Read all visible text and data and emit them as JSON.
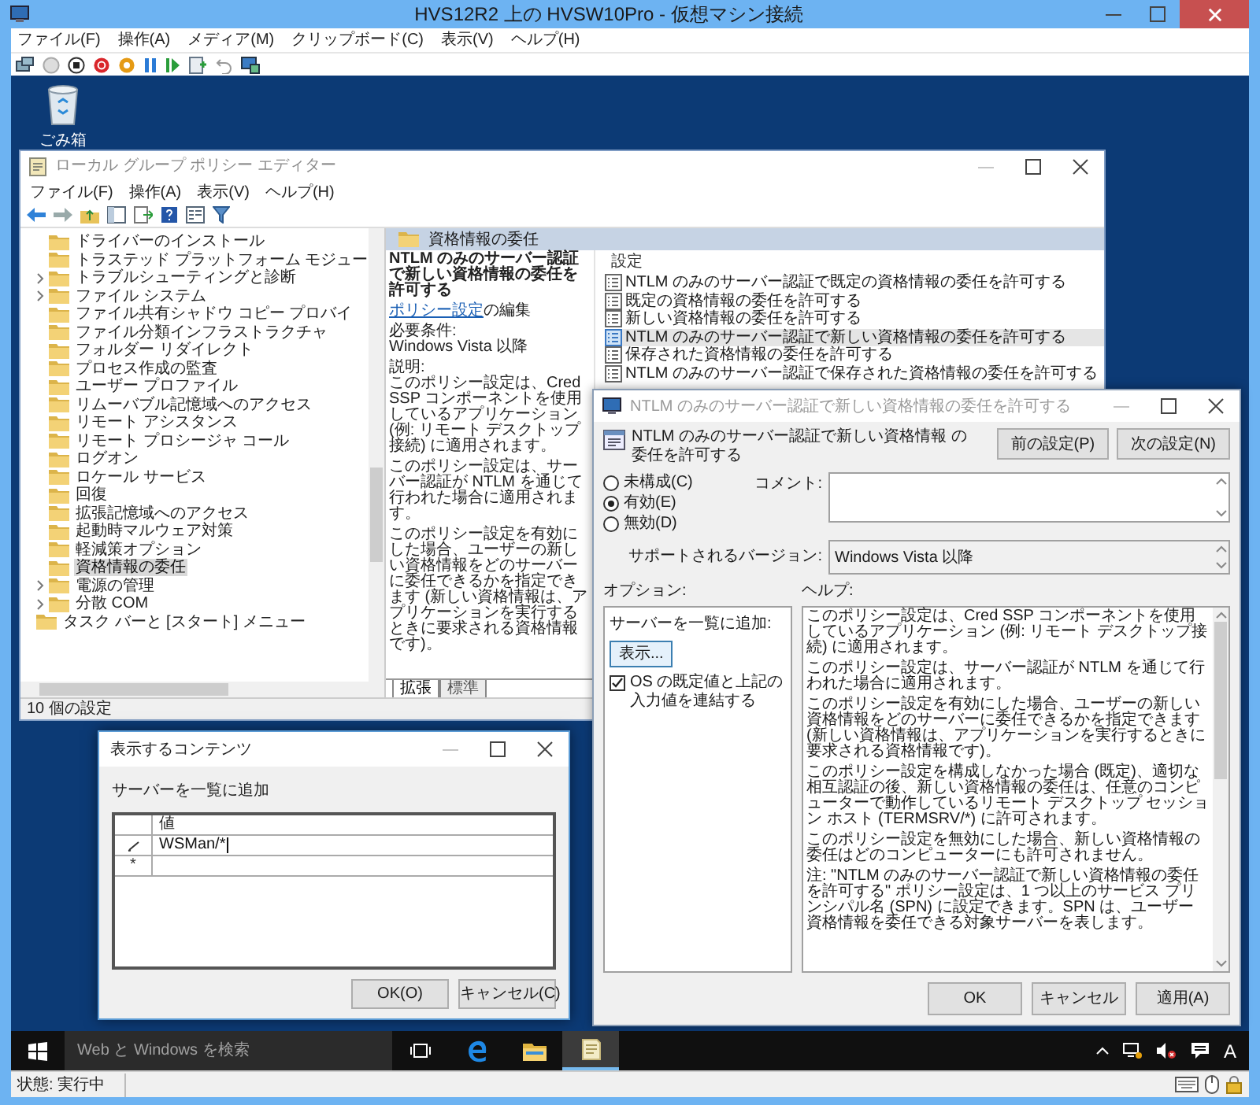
{
  "vm_window": {
    "title": "HVS12R2 上の HVSW10Pro - 仮想マシン接続",
    "menu": [
      "ファイル(F)",
      "操作(A)",
      "メディア(M)",
      "クリップボード(C)",
      "表示(V)",
      "ヘルプ(H)"
    ]
  },
  "desktop_icons": [
    {
      "label": "ごみ箱"
    }
  ],
  "policy_editor": {
    "title": "ローカル グループ ポリシー エディター",
    "menu": [
      "ファイル(F)",
      "操作(A)",
      "表示(V)",
      "ヘルプ(H)"
    ],
    "tree": {
      "children": [
        {
          "label": "ドライバーのインストール",
          "expandable": false,
          "selected": false
        },
        {
          "label": "トラステッド プラットフォーム モジュー",
          "expandable": false,
          "selected": false
        },
        {
          "label": "トラブルシューティングと診断",
          "expandable": true,
          "selected": false
        },
        {
          "label": "ファイル システム",
          "expandable": true,
          "selected": false
        },
        {
          "label": "ファイル共有シャドウ コピー プロバイ",
          "expandable": false,
          "selected": false
        },
        {
          "label": "ファイル分類インフラストラクチャ",
          "expandable": false,
          "selected": false
        },
        {
          "label": "フォルダー リダイレクト",
          "expandable": false,
          "selected": false
        },
        {
          "label": "プロセス作成の監査",
          "expandable": false,
          "selected": false
        },
        {
          "label": "ユーザー プロファイル",
          "expandable": false,
          "selected": false
        },
        {
          "label": "リムーバブル記憶域へのアクセス",
          "expandable": false,
          "selected": false
        },
        {
          "label": "リモート アシスタンス",
          "expandable": false,
          "selected": false
        },
        {
          "label": "リモート プロシージャ コール",
          "expandable": false,
          "selected": false
        },
        {
          "label": "ログオン",
          "expandable": false,
          "selected": false
        },
        {
          "label": "ロケール サービス",
          "expandable": false,
          "selected": false
        },
        {
          "label": "回復",
          "expandable": false,
          "selected": false
        },
        {
          "label": "拡張記憶域へのアクセス",
          "expandable": false,
          "selected": false
        },
        {
          "label": "起動時マルウェア対策",
          "expandable": false,
          "selected": false
        },
        {
          "label": "軽減策オプション",
          "expandable": false,
          "selected": false
        },
        {
          "label": "資格情報の委任",
          "expandable": false,
          "selected": true
        },
        {
          "label": "電源の管理",
          "expandable": true,
          "selected": false
        },
        {
          "label": "分散 COM",
          "expandable": true,
          "selected": false
        }
      ],
      "after": [
        {
          "label": "タスク バーと [スタート] メニュー",
          "expandable": false,
          "selected": false
        }
      ]
    },
    "header": "資格情報の委任",
    "description": {
      "title": "NTLM のみのサーバー認証で新しい資格情報の委任を許可する",
      "link": "ポリシー設定",
      "link_suffix": "の編集",
      "requirements_label": "必要条件:",
      "requirements": "Windows Vista 以降",
      "description_label": "説明:",
      "paragraphs": [
        "このポリシー設定は、Cred SSP コンポーネントを使用しているアプリケーション (例: リモート デスクトップ接続) に適用されます。",
        "このポリシー設定は、サーバー認証が NTLM を通じて行われた場合に適用されます。",
        "このポリシー設定を有効にした場合、ユーザーの新しい資格情報をどのサーバーに委任できるかを指定できます (新しい資格情報は、アプリケーションを実行するときに要求される資格情報です)。"
      ]
    },
    "settings": {
      "header": "設定",
      "items": [
        {
          "label": "NTLM のみのサーバー認証で既定の資格情報の委任を許可する",
          "selected": false
        },
        {
          "label": "既定の資格情報の委任を許可する",
          "selected": false
        },
        {
          "label": "新しい資格情報の委任を許可する",
          "selected": false
        },
        {
          "label": "NTLM のみのサーバー認証で新しい資格情報の委任を許可する",
          "selected": true
        },
        {
          "label": "保存された資格情報の委任を許可する",
          "selected": false
        },
        {
          "label": "NTLM のみのサーバー認証で保存された資格情報の委任を許可する",
          "selected": false
        }
      ]
    },
    "tabs": [
      {
        "label": "拡張",
        "selected": true
      },
      {
        "label": "標準",
        "selected": false
      }
    ],
    "status": "10 個の設定"
  },
  "policy_dialog": {
    "title": "NTLM のみのサーバー認証で新しい資格情報の委任を許可する",
    "heading": "NTLM のみのサーバー認証で新しい資格情報 の委任を許可する",
    "nav_buttons": [
      "前の設定(P)",
      "次の設定(N)"
    ],
    "radios": [
      {
        "label": "未構成(C)",
        "selected": false
      },
      {
        "label": "有効(E)",
        "selected": true
      },
      {
        "label": "無効(D)",
        "selected": false
      }
    ],
    "comment_label": "コメント:",
    "supported_label": "サポートされるバージョン:",
    "supported": "Windows Vista 以降",
    "options_label": "オプション:",
    "help_label": "ヘルプ:",
    "options": {
      "list_label": "サーバーを一覧に追加:",
      "show_button": "表示...",
      "checkbox": {
        "label": "OS の既定値と上記の入力値を連結する",
        "checked": true
      }
    },
    "help": [
      "このポリシー設定は、Cred SSP コンポーネントを使用しているアプリケーション (例: リモート デスクトップ接続) に適用されます。",
      "このポリシー設定は、サーバー認証が NTLM を通じて行われた場合に適用されます。",
      "このポリシー設定を有効にした場合、ユーザーの新しい資格情報をどのサーバーに委任できるかを指定できます (新しい資格情報は、アプリケーションを実行するときに要求される資格情報です)。",
      "このポリシー設定を構成しなかった場合 (既定)、適切な相互認証の後、新しい資格情報の委任は、任意のコンピューターで動作しているリモート デスクトップ セッション ホスト (TERMSRV/*) に許可されます。",
      "このポリシー設定を無効にした場合、新しい資格情報の委任はどのコンピューターにも許可されません。",
      "注: \"NTLM のみのサーバー認証で新しい資格情報の委任を許可する\" ポリシー設定は、1 つ以上のサービス プリンシパル名 (SPN) に設定できます。SPN は、ユーザー資格情報を委任できる対象サーバーを表します。"
    ],
    "buttons": [
      "OK",
      "キャンセル",
      "適用(A)"
    ]
  },
  "contents_dialog": {
    "title": "表示するコンテンツ",
    "label": "サーバーを一覧に追加",
    "column": "値",
    "rows": [
      {
        "kind": "editing",
        "value": "WSMan/*"
      },
      {
        "kind": "new",
        "marker": "*"
      }
    ],
    "buttons": [
      "OK(O)",
      "キャンセル(C)"
    ]
  },
  "taskbar": {
    "search_placeholder": "Web と Windows を検索",
    "apps": [
      {
        "kind": "task-view",
        "selected": false
      },
      {
        "kind": "edge",
        "selected": false
      },
      {
        "kind": "explorer",
        "selected": false
      },
      {
        "kind": "editor",
        "selected": true
      }
    ],
    "ime": "A"
  },
  "status_bar": "状態: 実行中"
}
